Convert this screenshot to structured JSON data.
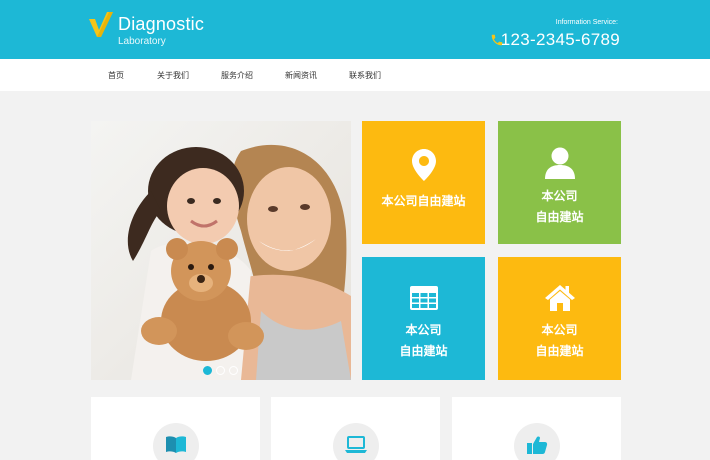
{
  "header": {
    "logo_title": "Diagnostic",
    "logo_sub": "Laboratory",
    "info_label": "Information Service:",
    "phone": "123-2345-6789",
    "icons": [
      "check-logo-icon",
      "phone-icon"
    ]
  },
  "nav": {
    "items": [
      "首页",
      "关于我们",
      "服务介绍",
      "新闻资讯",
      "联系我们"
    ]
  },
  "slider": {
    "image": "mother-and-daughter-photo",
    "dots": 3,
    "active_dot": 1
  },
  "tiles": [
    {
      "lines": [
        "本公司自由建站"
      ],
      "icon": "map-pin-icon",
      "color": "#fdba10"
    },
    {
      "lines": [
        "本公司",
        "自由建站"
      ],
      "icon": "user-icon",
      "color": "#8ac148"
    },
    {
      "lines": [
        "本公司",
        "自由建站"
      ],
      "icon": "table-icon",
      "color": "#1db8d6"
    },
    {
      "lines": [
        "本公司",
        "自由建站"
      ],
      "icon": "home-icon",
      "color": "#fdba10"
    }
  ],
  "cards": [
    {
      "icon": "book-icon"
    },
    {
      "icon": "laptop-icon"
    },
    {
      "icon": "thumbs-up-icon"
    }
  ],
  "colors": {
    "accent": "#1db8d6",
    "yellow": "#fdba10",
    "green": "#8ac148",
    "background": "#f2f2f2"
  }
}
